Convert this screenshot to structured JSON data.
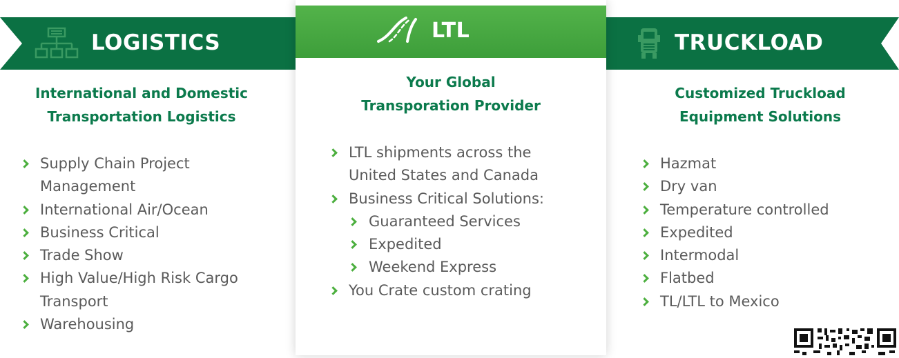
{
  "logistics": {
    "title": "LOGISTICS",
    "icon": "org-chart-icon",
    "heading": [
      "International and Domestic",
      "Transportation Logistics"
    ],
    "items": [
      {
        "label": "Supply Chain Project",
        "cont": "Management"
      },
      {
        "label": "International Air/Ocean"
      },
      {
        "label": "Business Critical"
      },
      {
        "label": "Trade Show"
      },
      {
        "label": "High Value/High Risk Cargo",
        "cont": "Transport"
      },
      {
        "label": "Warehousing"
      }
    ]
  },
  "ltl": {
    "title": "LTL",
    "icon": "highway-icon",
    "heading": [
      "Your Global",
      "Transporation Provider"
    ],
    "items": [
      {
        "label": "LTL shipments across the",
        "cont": "United States and Canada"
      },
      {
        "label": "Business Critical Solutions:"
      },
      {
        "label": "Guaranteed Services",
        "sub": true
      },
      {
        "label": "Expedited",
        "sub": true
      },
      {
        "label": "Weekend Express",
        "sub": true
      },
      {
        "label": "You Crate custom crating"
      }
    ]
  },
  "truckload": {
    "title": "TRUCKLOAD",
    "icon": "truck-icon",
    "heading": [
      "Customized Truckload",
      "Equipment Solutions"
    ],
    "items": [
      {
        "label": "Hazmat"
      },
      {
        "label": "Dry van"
      },
      {
        "label": "Temperature controlled"
      },
      {
        "label": "Expedited"
      },
      {
        "label": "Intermodal"
      },
      {
        "label": "Flatbed"
      },
      {
        "label": "TL/LTL to Mexico"
      }
    ]
  },
  "colors": {
    "dark_green": "#0b7143",
    "light_green": "#4caf3e",
    "heading_green": "#0b7a4c",
    "text_gray": "#5a5a5a"
  }
}
